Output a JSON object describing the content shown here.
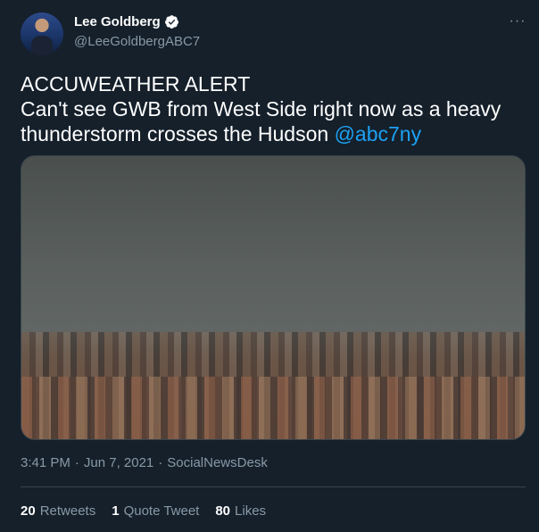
{
  "author": {
    "name": "Lee Goldberg",
    "handle": "@LeeGoldbergABC7",
    "verified_icon": "verified-badge-icon",
    "avatar_icon": "avatar-photo"
  },
  "more_icon": "more-options-icon",
  "tweet": {
    "line1": "ACCUWEATHER ALERT",
    "line2": "Can't see GWB from West Side right now as a heavy",
    "line3": "thunderstorm crosses the Hudson",
    "mention": "@abc7ny"
  },
  "media": {
    "description_icon": "storm-city-photo"
  },
  "meta": {
    "time": "3:41 PM",
    "separator1": "·",
    "date": "Jun 7, 2021",
    "separator2": "·",
    "source": "SocialNewsDesk"
  },
  "stats": {
    "retweets_count": "20",
    "retweets_label": "Retweets",
    "quotes_count": "1",
    "quotes_label": "Quote Tweet",
    "likes_count": "80",
    "likes_label": "Likes"
  },
  "colors": {
    "background": "#15202b",
    "link": "#1da1f2",
    "secondary_text": "#8899a6",
    "border": "#38444d"
  }
}
